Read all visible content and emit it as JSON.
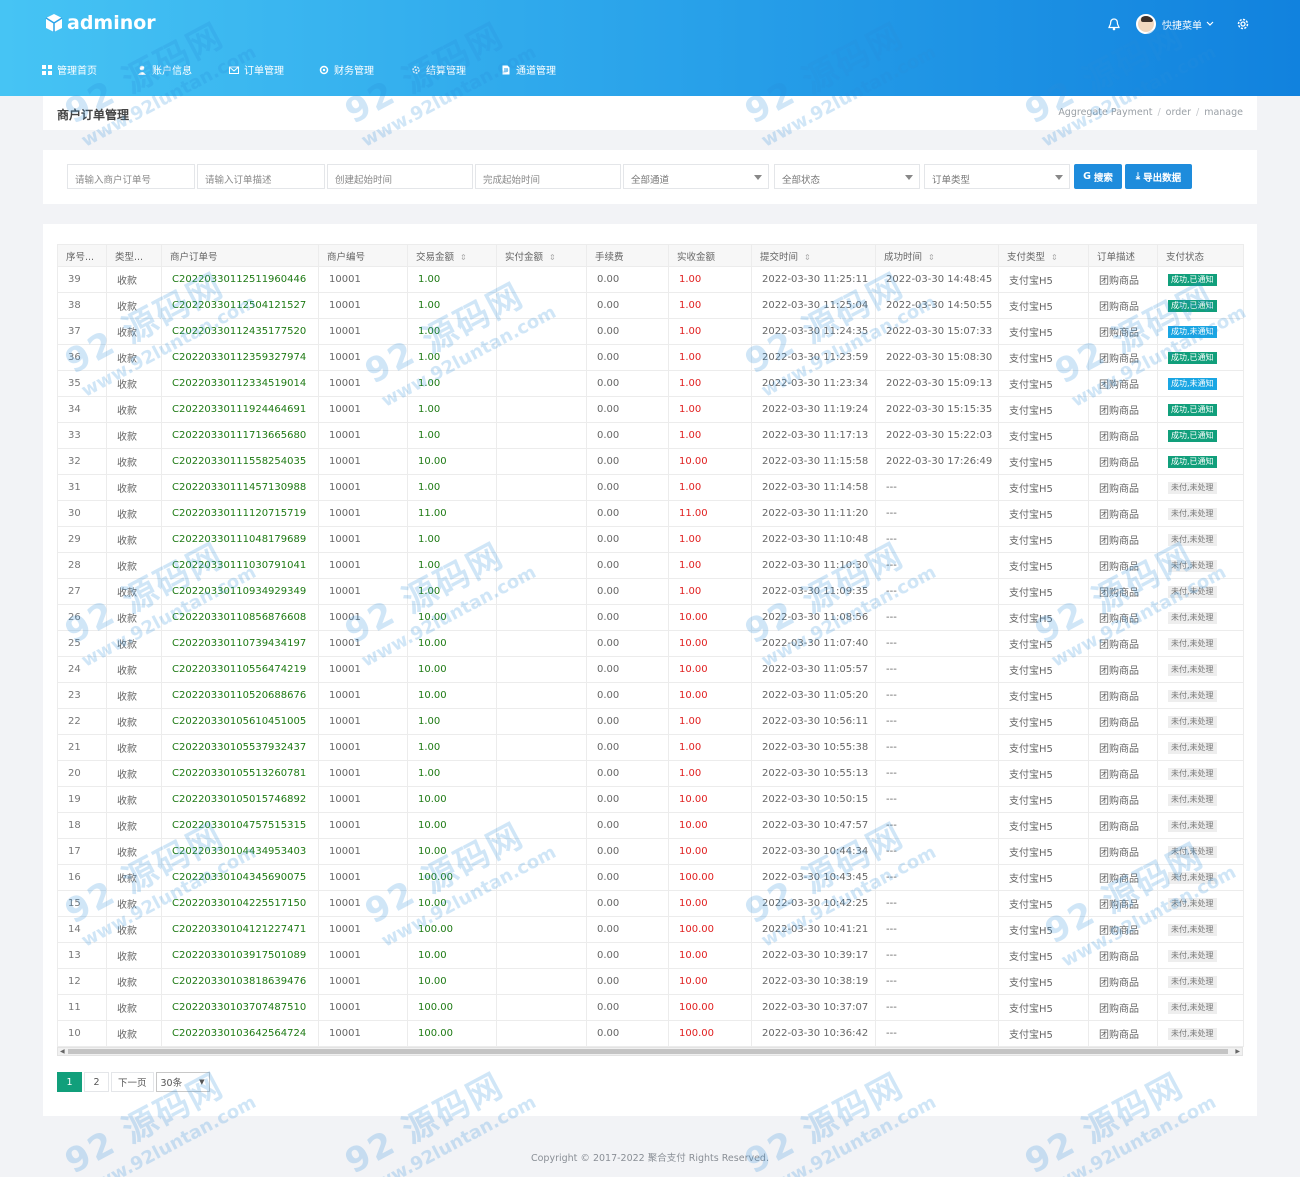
{
  "app": {
    "logo_text": "adminor"
  },
  "nav": [
    {
      "label": "管理首页",
      "icon": "grid-icon"
    },
    {
      "label": "账户信息",
      "icon": "user-icon"
    },
    {
      "label": "订单管理",
      "icon": "mail-icon"
    },
    {
      "label": "财务管理",
      "icon": "settings-icon"
    },
    {
      "label": "结算管理",
      "icon": "gear-icon"
    },
    {
      "label": "通道管理",
      "icon": "file-icon"
    }
  ],
  "header": {
    "user_menu": "快捷菜单"
  },
  "page": {
    "title": "商户订单管理",
    "breadcrumb": [
      "Aggregate Payment",
      "order",
      "manage"
    ]
  },
  "filters": {
    "order_no_placeholder": "请输入商户订单号",
    "desc_placeholder": "请输入订单描述",
    "create_start_placeholder": "创建起始时间",
    "finish_start_placeholder": "完成起始时间",
    "channel_select": "全部通道",
    "status_select": "全部状态",
    "type_select": "订单类型",
    "search_label": "搜索",
    "export_label": "导出数据"
  },
  "table": {
    "columns": [
      "序号...",
      "类型...",
      "商户订单号",
      "商户编号",
      "交易金额",
      "实付金额",
      "手续费",
      "实收金额",
      "提交时间",
      "成功时间",
      "支付类型",
      "订单描述",
      "支付状态"
    ],
    "rows": [
      [
        "39",
        "收款",
        "C20220330112511960446",
        "10001",
        "1.00",
        "",
        "0.00",
        "1.00",
        "2022-03-30 11:25:11",
        "2022-03-30 14:48:45",
        "支付宝H5",
        "团购商品",
        "成功,已通知"
      ],
      [
        "38",
        "收款",
        "C20220330112504121527",
        "10001",
        "1.00",
        "",
        "0.00",
        "1.00",
        "2022-03-30 11:25:04",
        "2022-03-30 14:50:55",
        "支付宝H5",
        "团购商品",
        "成功,已通知"
      ],
      [
        "37",
        "收款",
        "C20220330112435177520",
        "10001",
        "1.00",
        "",
        "0.00",
        "1.00",
        "2022-03-30 11:24:35",
        "2022-03-30 15:07:33",
        "支付宝H5",
        "团购商品",
        "成功,未通知"
      ],
      [
        "36",
        "收款",
        "C20220330112359327974",
        "10001",
        "1.00",
        "",
        "0.00",
        "1.00",
        "2022-03-30 11:23:59",
        "2022-03-30 15:08:30",
        "支付宝H5",
        "团购商品",
        "成功,已通知"
      ],
      [
        "35",
        "收款",
        "C20220330112334519014",
        "10001",
        "1.00",
        "",
        "0.00",
        "1.00",
        "2022-03-30 11:23:34",
        "2022-03-30 15:09:13",
        "支付宝H5",
        "团购商品",
        "成功,未通知"
      ],
      [
        "34",
        "收款",
        "C20220330111924464691",
        "10001",
        "1.00",
        "",
        "0.00",
        "1.00",
        "2022-03-30 11:19:24",
        "2022-03-30 15:15:35",
        "支付宝H5",
        "团购商品",
        "成功,已通知"
      ],
      [
        "33",
        "收款",
        "C20220330111713665680",
        "10001",
        "1.00",
        "",
        "0.00",
        "1.00",
        "2022-03-30 11:17:13",
        "2022-03-30 15:22:03",
        "支付宝H5",
        "团购商品",
        "成功,已通知"
      ],
      [
        "32",
        "收款",
        "C20220330111558254035",
        "10001",
        "10.00",
        "",
        "0.00",
        "10.00",
        "2022-03-30 11:15:58",
        "2022-03-30 17:26:49",
        "支付宝H5",
        "团购商品",
        "成功,已通知"
      ],
      [
        "31",
        "收款",
        "C20220330111457130988",
        "10001",
        "1.00",
        "",
        "0.00",
        "1.00",
        "2022-03-30 11:14:58",
        "---",
        "支付宝H5",
        "团购商品",
        "未付,未处理"
      ],
      [
        "30",
        "收款",
        "C20220330111120715719",
        "10001",
        "11.00",
        "",
        "0.00",
        "11.00",
        "2022-03-30 11:11:20",
        "---",
        "支付宝H5",
        "团购商品",
        "未付,未处理"
      ],
      [
        "29",
        "收款",
        "C20220330111048179689",
        "10001",
        "1.00",
        "",
        "0.00",
        "1.00",
        "2022-03-30 11:10:48",
        "---",
        "支付宝H5",
        "团购商品",
        "未付,未处理"
      ],
      [
        "28",
        "收款",
        "C20220330111030791041",
        "10001",
        "1.00",
        "",
        "0.00",
        "1.00",
        "2022-03-30 11:10:30",
        "---",
        "支付宝H5",
        "团购商品",
        "未付,未处理"
      ],
      [
        "27",
        "收款",
        "C20220330110934929349",
        "10001",
        "1.00",
        "",
        "0.00",
        "1.00",
        "2022-03-30 11:09:35",
        "---",
        "支付宝H5",
        "团购商品",
        "未付,未处理"
      ],
      [
        "26",
        "收款",
        "C20220330110856876608",
        "10001",
        "10.00",
        "",
        "0.00",
        "10.00",
        "2022-03-30 11:08:56",
        "---",
        "支付宝H5",
        "团购商品",
        "未付,未处理"
      ],
      [
        "25",
        "收款",
        "C20220330110739434197",
        "10001",
        "10.00",
        "",
        "0.00",
        "10.00",
        "2022-03-30 11:07:40",
        "---",
        "支付宝H5",
        "团购商品",
        "未付,未处理"
      ],
      [
        "24",
        "收款",
        "C20220330110556474219",
        "10001",
        "10.00",
        "",
        "0.00",
        "10.00",
        "2022-03-30 11:05:57",
        "---",
        "支付宝H5",
        "团购商品",
        "未付,未处理"
      ],
      [
        "23",
        "收款",
        "C20220330110520688676",
        "10001",
        "10.00",
        "",
        "0.00",
        "10.00",
        "2022-03-30 11:05:20",
        "---",
        "支付宝H5",
        "团购商品",
        "未付,未处理"
      ],
      [
        "22",
        "收款",
        "C20220330105610451005",
        "10001",
        "1.00",
        "",
        "0.00",
        "1.00",
        "2022-03-30 10:56:11",
        "---",
        "支付宝H5",
        "团购商品",
        "未付,未处理"
      ],
      [
        "21",
        "收款",
        "C20220330105537932437",
        "10001",
        "1.00",
        "",
        "0.00",
        "1.00",
        "2022-03-30 10:55:38",
        "---",
        "支付宝H5",
        "团购商品",
        "未付,未处理"
      ],
      [
        "20",
        "收款",
        "C20220330105513260781",
        "10001",
        "1.00",
        "",
        "0.00",
        "1.00",
        "2022-03-30 10:55:13",
        "---",
        "支付宝H5",
        "团购商品",
        "未付,未处理"
      ],
      [
        "19",
        "收款",
        "C20220330105015746892",
        "10001",
        "10.00",
        "",
        "0.00",
        "10.00",
        "2022-03-30 10:50:15",
        "---",
        "支付宝H5",
        "团购商品",
        "未付,未处理"
      ],
      [
        "18",
        "收款",
        "C20220330104757515315",
        "10001",
        "10.00",
        "",
        "0.00",
        "10.00",
        "2022-03-30 10:47:57",
        "---",
        "支付宝H5",
        "团购商品",
        "未付,未处理"
      ],
      [
        "17",
        "收款",
        "C20220330104434953403",
        "10001",
        "10.00",
        "",
        "0.00",
        "10.00",
        "2022-03-30 10:44:34",
        "---",
        "支付宝H5",
        "团购商品",
        "未付,未处理"
      ],
      [
        "16",
        "收款",
        "C20220330104345690075",
        "10001",
        "100.00",
        "",
        "0.00",
        "100.00",
        "2022-03-30 10:43:45",
        "---",
        "支付宝H5",
        "团购商品",
        "未付,未处理"
      ],
      [
        "15",
        "收款",
        "C20220330104225517150",
        "10001",
        "10.00",
        "",
        "0.00",
        "10.00",
        "2022-03-30 10:42:25",
        "---",
        "支付宝H5",
        "团购商品",
        "未付,未处理"
      ],
      [
        "14",
        "收款",
        "C20220330104121227471",
        "10001",
        "100.00",
        "",
        "0.00",
        "100.00",
        "2022-03-30 10:41:21",
        "---",
        "支付宝H5",
        "团购商品",
        "未付,未处理"
      ],
      [
        "13",
        "收款",
        "C20220330103917501089",
        "10001",
        "10.00",
        "",
        "0.00",
        "10.00",
        "2022-03-30 10:39:17",
        "---",
        "支付宝H5",
        "团购商品",
        "未付,未处理"
      ],
      [
        "12",
        "收款",
        "C20220330103818639476",
        "10001",
        "10.00",
        "",
        "0.00",
        "10.00",
        "2022-03-30 10:38:19",
        "---",
        "支付宝H5",
        "团购商品",
        "未付,未处理"
      ],
      [
        "11",
        "收款",
        "C20220330103707487510",
        "10001",
        "100.00",
        "",
        "0.00",
        "100.00",
        "2022-03-30 10:37:07",
        "---",
        "支付宝H5",
        "团购商品",
        "未付,未处理"
      ],
      [
        "10",
        "收款",
        "C20220330103642564724",
        "10001",
        "100.00",
        "",
        "0.00",
        "100.00",
        "2022-03-30 10:36:42",
        "---",
        "支付宝H5",
        "团购商品",
        "未付,未处理"
      ]
    ]
  },
  "pagination": {
    "pages": [
      "1",
      "2"
    ],
    "next_label": "下一页",
    "page_size": "30条"
  },
  "footer": {
    "copyright": "Copyright © 2017-2022 聚合支付 Rights Reserved."
  },
  "watermark": {
    "brand": "92 源码网",
    "site": "www.92luntan.com"
  },
  "colors": {
    "header_start": "#46c4f4",
    "header_end": "#1182de",
    "success_notified": "#119f7b",
    "success_unnotified": "#1aa6e3",
    "primary_button": "#1e8cdc",
    "amount_green": "#1e7a14",
    "amount_red": "#e02020"
  }
}
